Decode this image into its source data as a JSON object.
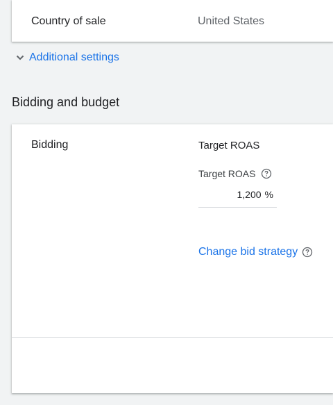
{
  "country": {
    "label": "Country of sale",
    "value": "United States"
  },
  "additional_settings": {
    "label": "Additional settings",
    "icon": "chevron-down-icon"
  },
  "section": {
    "title": "Bidding and budget"
  },
  "bidding": {
    "label": "Bidding",
    "strategy": "Target ROAS",
    "target_roas_label": "Target ROAS",
    "target_roas_value": "1,200",
    "target_roas_unit": "%",
    "help_icon": "help-circle-icon",
    "change_link": "Change bid strategy"
  },
  "colors": {
    "link": "#1a73e8",
    "text": "#202124",
    "secondary_text": "#5f6368",
    "background": "#f1f3f4",
    "card": "#ffffff"
  }
}
